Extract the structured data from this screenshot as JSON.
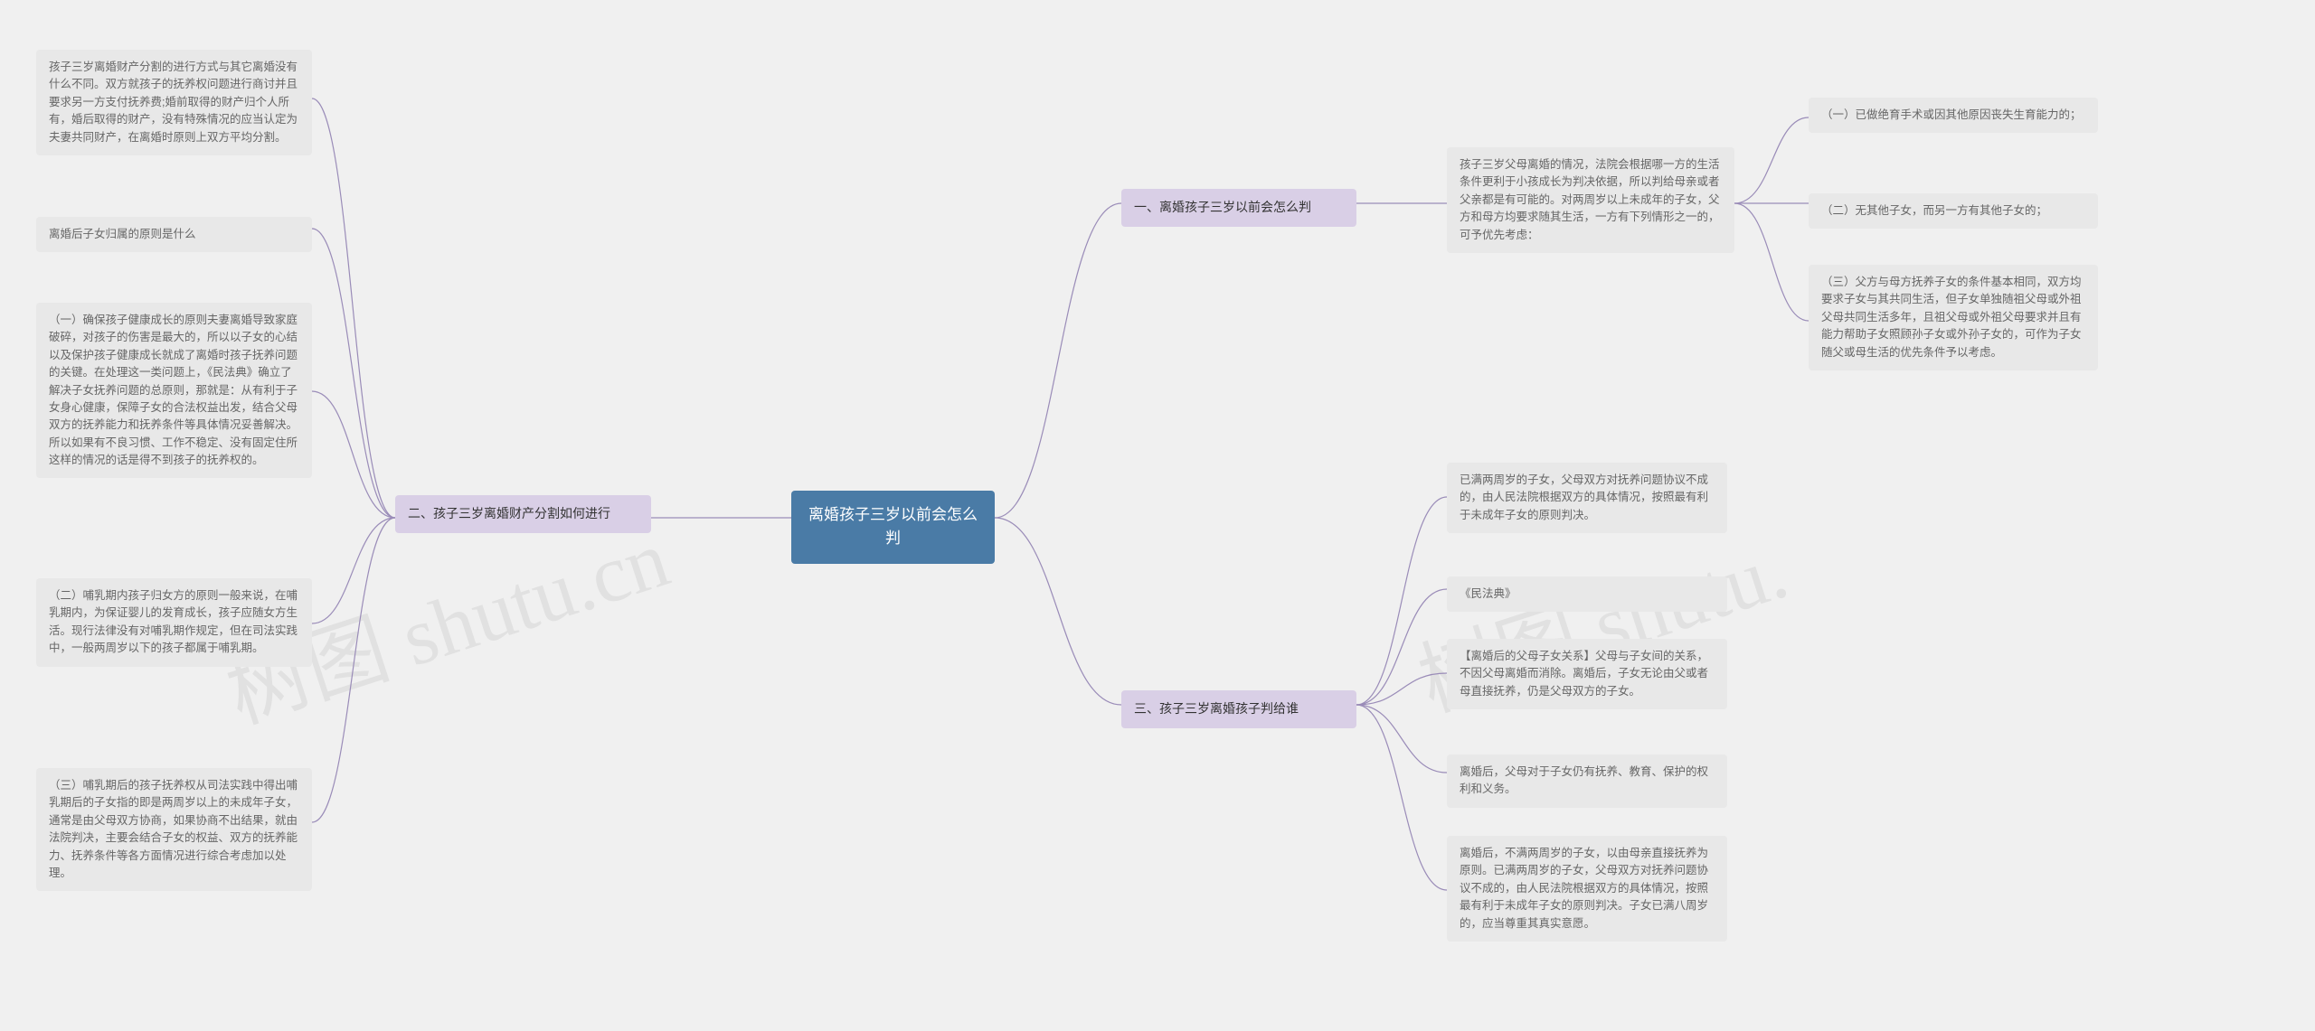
{
  "root": {
    "text": "离婚孩子三岁以前会怎么判"
  },
  "branches": {
    "b1": {
      "label": "一、离婚孩子三岁以前会怎么判",
      "children": {
        "c1": {
          "text": "孩子三岁父母离婚的情况，法院会根据哪一方的生活条件更利于小孩成长为判决依据，所以判给母亲或者父亲都是有可能的。对两周岁以上未成年的子女，父方和母方均要求随其生活，一方有下列情形之一的，可予优先考虑：",
          "sub": {
            "s1": "（一）已做绝育手术或因其他原因丧失生育能力的；",
            "s2": "（二）无其他子女，而另一方有其他子女的；",
            "s3": "（三）父方与母方抚养子女的条件基本相同，双方均要求子女与其共同生活，但子女单独随祖父母或外祖父母共同生活多年，且祖父母或外祖父母要求并且有能力帮助子女照顾孙子女或外孙子女的，可作为子女随父或母生活的优先条件予以考虑。"
          }
        }
      }
    },
    "b2": {
      "label": "二、孩子三岁离婚财产分割如何进行",
      "children": {
        "c1": {
          "text": "孩子三岁离婚财产分割的进行方式与其它离婚没有什么不同。双方就孩子的抚养权问题进行商讨并且要求另一方支付抚养费;婚前取得的财产归个人所有，婚后取得的财产，没有特殊情况的应当认定为夫妻共同财产，在离婚时原则上双方平均分割。"
        },
        "c2": {
          "text": "离婚后子女归属的原则是什么"
        },
        "c3": {
          "text": "（一）确保孩子健康成长的原则夫妻离婚导致家庭破碎，对孩子的伤害是最大的，所以以子女的心结以及保护孩子健康成长就成了离婚时孩子抚养问题的关键。在处理这一类问题上，《民法典》确立了解决子女抚养问题的总原则，那就是：从有利于子女身心健康，保障子女的合法权益出发，结合父母双方的抚养能力和抚养条件等具体情况妥善解决。所以如果有不良习惯、工作不稳定、没有固定住所这样的情况的话是得不到孩子的抚养权的。"
        },
        "c4": {
          "text": "（二）哺乳期内孩子归女方的原则一般来说，在哺乳期内，为保证婴儿的发育成长，孩子应随女方生活。现行法律没有对哺乳期作规定，但在司法实践中，一般两周岁以下的孩子都属于哺乳期。"
        },
        "c5": {
          "text": "（三）哺乳期后的孩子抚养权从司法实践中得出哺乳期后的子女指的即是两周岁以上的未成年子女，通常是由父母双方协商，如果协商不出结果，就由法院判决，主要会结合子女的权益、双方的抚养能力、抚养条件等各方面情况进行综合考虑加以处理。"
        }
      }
    },
    "b3": {
      "label": "三、孩子三岁离婚孩子判给谁",
      "children": {
        "c1": {
          "text": "已满两周岁的子女，父母双方对抚养问题协议不成的，由人民法院根据双方的具体情况，按照最有利于未成年子女的原则判决。"
        },
        "c2": {
          "text": "《民法典》"
        },
        "c3": {
          "text": "【离婚后的父母子女关系】父母与子女间的关系，不因父母离婚而消除。离婚后，子女无论由父或者母直接抚养，仍是父母双方的子女。"
        },
        "c4": {
          "text": "离婚后，父母对于子女仍有抚养、教育、保护的权利和义务。"
        },
        "c5": {
          "text": "离婚后，不满两周岁的子女，以由母亲直接抚养为原则。已满两周岁的子女，父母双方对抚养问题协议不成的，由人民法院根据双方的具体情况，按照最有利于未成年子女的原则判决。子女已满八周岁的，应当尊重其真实意愿。"
        }
      }
    }
  },
  "watermarks": {
    "w1": "树图 shutu.cn",
    "w2": "树图 shutu."
  }
}
